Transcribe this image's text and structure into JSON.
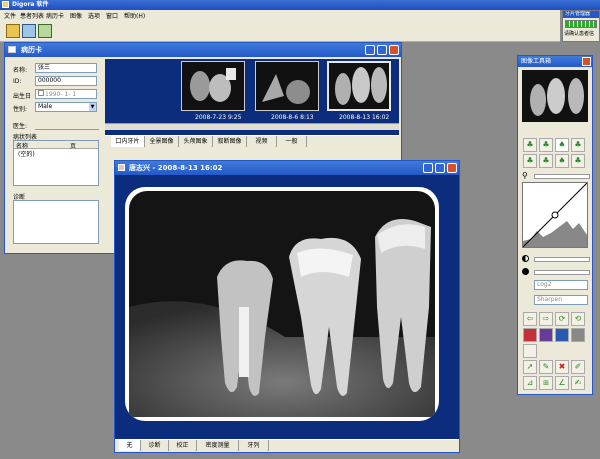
{
  "app": {
    "title": "Digora 软件",
    "menu": [
      "文件",
      "患者列表",
      "病历卡",
      "图像",
      "选项",
      "窗口",
      "帮助(H)"
    ]
  },
  "side_status": {
    "title": "牙片管理器",
    "text": "请确认患者信"
  },
  "patient_card": {
    "title": "病历卡",
    "name_label": "名称:",
    "name_value": "张三",
    "id_label": "ID:",
    "id_value": "000000",
    "dob_label": "出生日",
    "dob_value": "1990- 1- 1",
    "sex_label": "性别:",
    "sex_value": "Male",
    "doctor_label": "医生:",
    "disease_label": "病状列表",
    "col_name": "名称",
    "col_page": "页",
    "row_empty": "(空的)",
    "diagnosis_label": "诊断"
  },
  "thumbnails": [
    "2008-7-23 9:25",
    "2008-8-6 8:13",
    "2008-8-13 16:02"
  ],
  "image_tabs": [
    "口内牙片",
    "全景图像",
    "头颅图象",
    "叙断图像",
    "视频",
    "一般"
  ],
  "xray_window": {
    "title": "唐志兴 - 2008-8-13 16:02",
    "bottom_tabs": [
      "无",
      "诊断",
      "校正",
      "密度测量",
      "牙列"
    ]
  },
  "tools_panel": {
    "title": "图像工具箱",
    "combo1": "Log2",
    "combo2": "Sharpen"
  },
  "colors": {
    "title_blue": "#2458c8",
    "dark_blue": "#0c2d7d",
    "face": "#ece9d8",
    "status_green": "#2ea82e"
  }
}
